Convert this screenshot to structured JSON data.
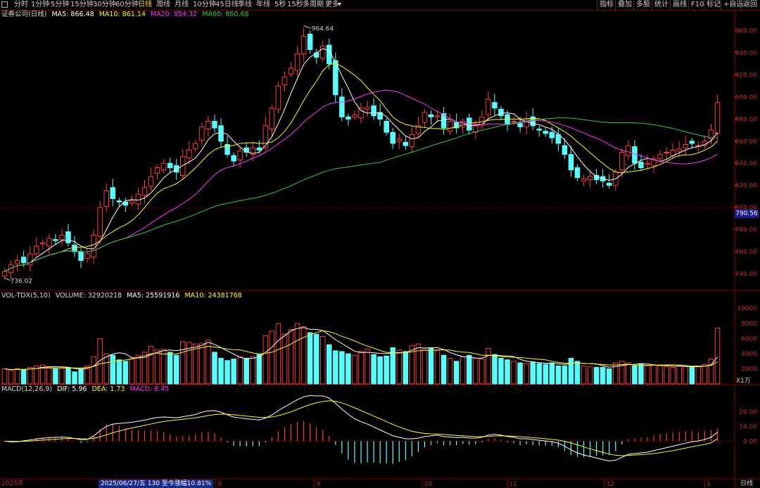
{
  "toolbar": {
    "periods": [
      "分时",
      "1分钟",
      "5分钟",
      "15分钟",
      "30分钟",
      "60分钟",
      "日线",
      "周线",
      "月线",
      "10分钟",
      "45日线",
      "季线",
      "年线",
      "5秒",
      "15秒",
      "多周期",
      "更多"
    ],
    "active_period": "日线",
    "right_buttons": [
      "指标",
      "叠加",
      "多股",
      "统计",
      "画线",
      "F10",
      "标记",
      "+自选",
      "返回"
    ]
  },
  "main_legend": {
    "title": "证券公司(日线)",
    "ma5": "MA5: 866.48",
    "ma10": "MA10: 861.14",
    "ma20": "MA20: 854.32",
    "ma60": "MA60: 860.68"
  },
  "vol_legend": {
    "name": "VOL-TDX(5,10)",
    "volume": "VOLUME: 32920218",
    "ma5": "MA5: 25591916",
    "ma10": "MA10: 24381768"
  },
  "macd_legend": {
    "name": "MACD(12,26,9)",
    "dif": "DIF: 5.96",
    "dea": "DEA: 1.73",
    "macd": "MACD: 8.45"
  },
  "annotations": {
    "high_label": "964.64",
    "low_label": "736.02",
    "current_price": "790.56",
    "vol_unit": "X1万",
    "period_label": "日线",
    "date_label": "2025年",
    "info_box": "2025/06/27/五 130 至今涨幅10.81%"
  },
  "colors": {
    "up": "#ff3c3c",
    "down": "#54ffff",
    "ma5": "#ffffff",
    "ma10": "#ffff00",
    "ma20": "#ff33ff",
    "ma60": "#33cc33"
  },
  "chart_data": {
    "type": "candlestick",
    "price_axis": {
      "ticks": [
        740,
        760,
        780,
        800,
        820,
        840,
        860,
        880,
        900,
        920,
        940,
        960
      ],
      "range": [
        730,
        970
      ]
    },
    "volume_axis": {
      "ticks": [
        2000,
        4000,
        6000,
        8000,
        10000
      ],
      "unit": "X1万"
    },
    "macd_axis": {
      "ticks": [
        0.0,
        10.0,
        20.0
      ]
    },
    "x_labels": [
      "2025年",
      "8",
      "9",
      "10",
      "11",
      "12",
      "1"
    ],
    "close": [
      742,
      748,
      752,
      750,
      758,
      765,
      768,
      772,
      770,
      775,
      768,
      760,
      752,
      758,
      775,
      800,
      815,
      808,
      805,
      802,
      806,
      812,
      818,
      828,
      836,
      840,
      836,
      832,
      846,
      852,
      858,
      873,
      878,
      872,
      860,
      848,
      842,
      851,
      850,
      854,
      852,
      874,
      890,
      910,
      918,
      926,
      939,
      955,
      943,
      936,
      946,
      930,
      902,
      882,
      880,
      884,
      890,
      891,
      883,
      880,
      868,
      858,
      862,
      856,
      866,
      874,
      886,
      882,
      883,
      872,
      878,
      872,
      878,
      870,
      874,
      882,
      898,
      890,
      883,
      875,
      878,
      873,
      880,
      874,
      870,
      867,
      863,
      858,
      848,
      834,
      827,
      826,
      828,
      825,
      824,
      820,
      832,
      850,
      856,
      840,
      836,
      840,
      844,
      848,
      850,
      852,
      853,
      857,
      858,
      856,
      860,
      870,
      895
    ],
    "volume": [
      2000,
      1800,
      2000,
      1900,
      2200,
      2400,
      2500,
      2300,
      2000,
      2100,
      2200,
      1600,
      2000,
      2400,
      3600,
      6000,
      4000,
      3800,
      3200,
      3000,
      3400,
      3800,
      4200,
      5000,
      4500,
      4600,
      4200,
      3800,
      5600,
      5500,
      5300,
      5400,
      5800,
      4200,
      3400,
      3100,
      3300,
      3600,
      3400,
      3600,
      3900,
      6400,
      7000,
      8000,
      6600,
      7200,
      8000,
      7600,
      6800,
      6600,
      6300,
      5200,
      4400,
      4300,
      4000,
      3800,
      4300,
      4600,
      3900,
      3600,
      3700,
      4800,
      4500,
      4300,
      5100,
      5300,
      4600,
      4700,
      4400,
      3800,
      3400,
      3000,
      3600,
      3800,
      3400,
      3300,
      4700,
      3900,
      3400,
      3200,
      3000,
      2800,
      2700,
      2900,
      2700,
      2600,
      2800,
      2400,
      2400,
      3400,
      3000,
      2400,
      2300,
      2200,
      2200,
      2000,
      2800,
      3000,
      2800,
      2400,
      2600,
      2400,
      2500,
      2400,
      2300,
      2200,
      2400,
      2300,
      2200,
      2300,
      2600,
      3300,
      7400
    ],
    "macd_dif": [
      0,
      -0.5,
      -0.4,
      0.2,
      0.8,
      1.5,
      2.0,
      2.4,
      2.6,
      2.8,
      2.5,
      1.8,
      1.0,
      1.2,
      3.5,
      7.0,
      10.0,
      11.5,
      12.0,
      12.3,
      12.8,
      13.5,
      14.2,
      15.2,
      16.0,
      16.3,
      16.1,
      15.8,
      16.5,
      17.2,
      18.0,
      19.5,
      20.5,
      20.6,
      19.6,
      17.8,
      16.2,
      15.7,
      15.1,
      14.8,
      14.3,
      15.6,
      17.6,
      20.6,
      23.1,
      25.6,
      28.0,
      30.0,
      30.8,
      30.6,
      30.6,
      29.1,
      25.6,
      21.6,
      18.1,
      15.1,
      13.1,
      11.6,
      9.6,
      7.6,
      5.6,
      3.6,
      2.6,
      1.6,
      1.6,
      2.1,
      3.1,
      3.6,
      4.1,
      3.1,
      2.8,
      2.4,
      2.6,
      2.1,
      2.1,
      2.6,
      4.1,
      4.6,
      4.1,
      3.1,
      2.6,
      1.6,
      1.6,
      1.1,
      0.6,
      0.1,
      -0.4,
      -1.4,
      -3.4,
      -5.9,
      -7.9,
      -9.4,
      -10.4,
      -11.4,
      -12.4,
      -13.4,
      -12.9,
      -10.9,
      -8.9,
      -8.4,
      -7.9,
      -7.4,
      -6.4,
      -5.4,
      -4.4,
      -3.4,
      -2.4,
      -1.4,
      -0.4,
      0.1,
      1.1,
      2.6,
      5.96
    ],
    "macd_dea": [
      0,
      -0.1,
      -0.2,
      -0.1,
      0.1,
      0.4,
      0.7,
      1.0,
      1.3,
      1.6,
      1.8,
      1.8,
      1.6,
      1.5,
      1.9,
      2.9,
      4.3,
      5.7,
      6.9,
      7.9,
      8.9,
      9.8,
      10.7,
      11.6,
      12.5,
      13.3,
      13.9,
      14.3,
      14.8,
      15.3,
      15.8,
      16.5,
      17.3,
      17.9,
      18.3,
      18.2,
      17.8,
      17.4,
      16.9,
      16.5,
      16.1,
      16.0,
      16.3,
      17.2,
      18.4,
      19.8,
      21.5,
      23.2,
      24.7,
      25.9,
      26.8,
      27.3,
      26.9,
      25.8,
      24.3,
      22.5,
      20.6,
      18.8,
      16.9,
      15.1,
      13.2,
      11.3,
      9.6,
      8.0,
      6.7,
      5.8,
      5.2,
      4.9,
      4.8,
      4.5,
      4.2,
      3.8,
      3.6,
      3.3,
      3.1,
      3.0,
      3.2,
      3.5,
      3.6,
      3.5,
      3.3,
      3.0,
      2.7,
      2.4,
      2.0,
      1.6,
      1.2,
      0.7,
      -0.1,
      -1.2,
      -2.5,
      -3.9,
      -5.2,
      -6.4,
      -7.6,
      -8.7,
      -9.5,
      -9.8,
      -9.6,
      -9.4,
      -9.1,
      -8.8,
      -8.4,
      -7.8,
      -7.1,
      -6.4,
      -5.6,
      -4.7,
      -3.8,
      -3.0,
      -2.2,
      -1.2,
      1.73
    ]
  }
}
